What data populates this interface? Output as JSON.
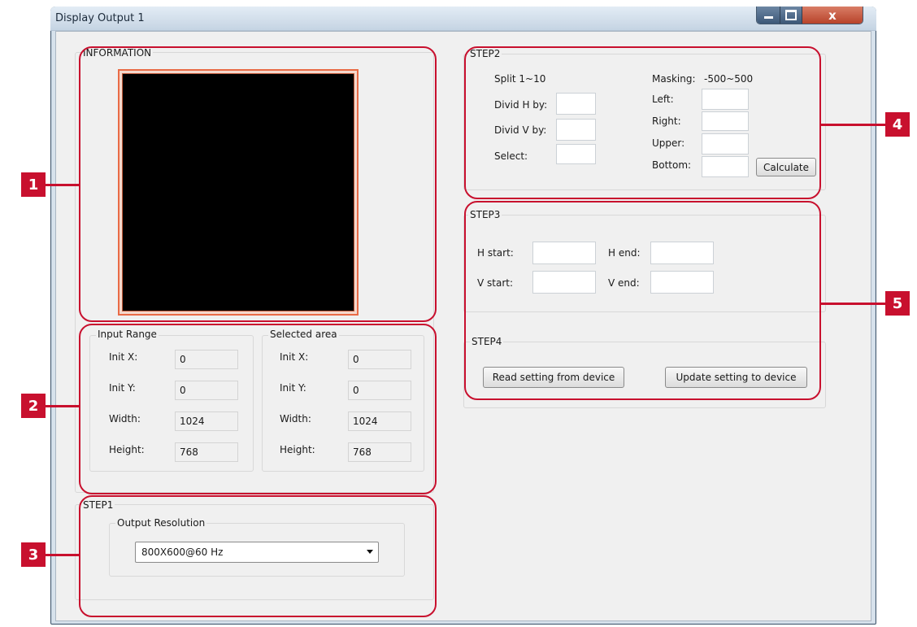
{
  "window": {
    "title": "Display Output 1",
    "close_glyph": "x",
    "icons": [
      "minimize-icon",
      "maximize-icon",
      "close-icon"
    ]
  },
  "information": {
    "label": "INFORMATION"
  },
  "input_range": {
    "label": "Input Range",
    "init_x_label": "Init X:",
    "init_x": "0",
    "init_y_label": "Init Y:",
    "init_y": "0",
    "width_label": "Width:",
    "width": "1024",
    "height_label": "Height:",
    "height": "768"
  },
  "selected_area": {
    "label": "Selected area",
    "init_x_label": "Init X:",
    "init_x": "0",
    "init_y_label": "Init Y:",
    "init_y": "0",
    "width_label": "Width:",
    "width": "1024",
    "height_label": "Height:",
    "height": "768"
  },
  "step1": {
    "label": "STEP1",
    "output_resolution_label": "Output Resolution",
    "output_resolution_value": "800X600@60 Hz"
  },
  "step2": {
    "label": "STEP2",
    "split_label": "Split 1~10",
    "divid_h_label": "Divid H by:",
    "divid_v_label": "Divid V by:",
    "select_label": "Select:",
    "masking_label": "Masking:",
    "masking_range": "-500~500",
    "left_label": "Left:",
    "right_label": "Right:",
    "upper_label": "Upper:",
    "bottom_label": "Bottom:",
    "calculate_button": "Calculate"
  },
  "step3": {
    "label": "STEP3",
    "h_start_label": "H start:",
    "h_end_label": "H end:",
    "v_start_label": "V start:",
    "v_end_label": "V end:"
  },
  "step4": {
    "label": "STEP4",
    "read_button": "Read setting from device",
    "update_button": "Update setting to device"
  },
  "callouts": {
    "badge_1": "1",
    "badge_2": "2",
    "badge_3": "3",
    "badge_4": "4",
    "badge_5": "5",
    "color": "#c8102e"
  },
  "colors": {
    "window_bg": "#f0f0f0",
    "preview_border": "#e96b46",
    "preview_bg": "#000000"
  }
}
